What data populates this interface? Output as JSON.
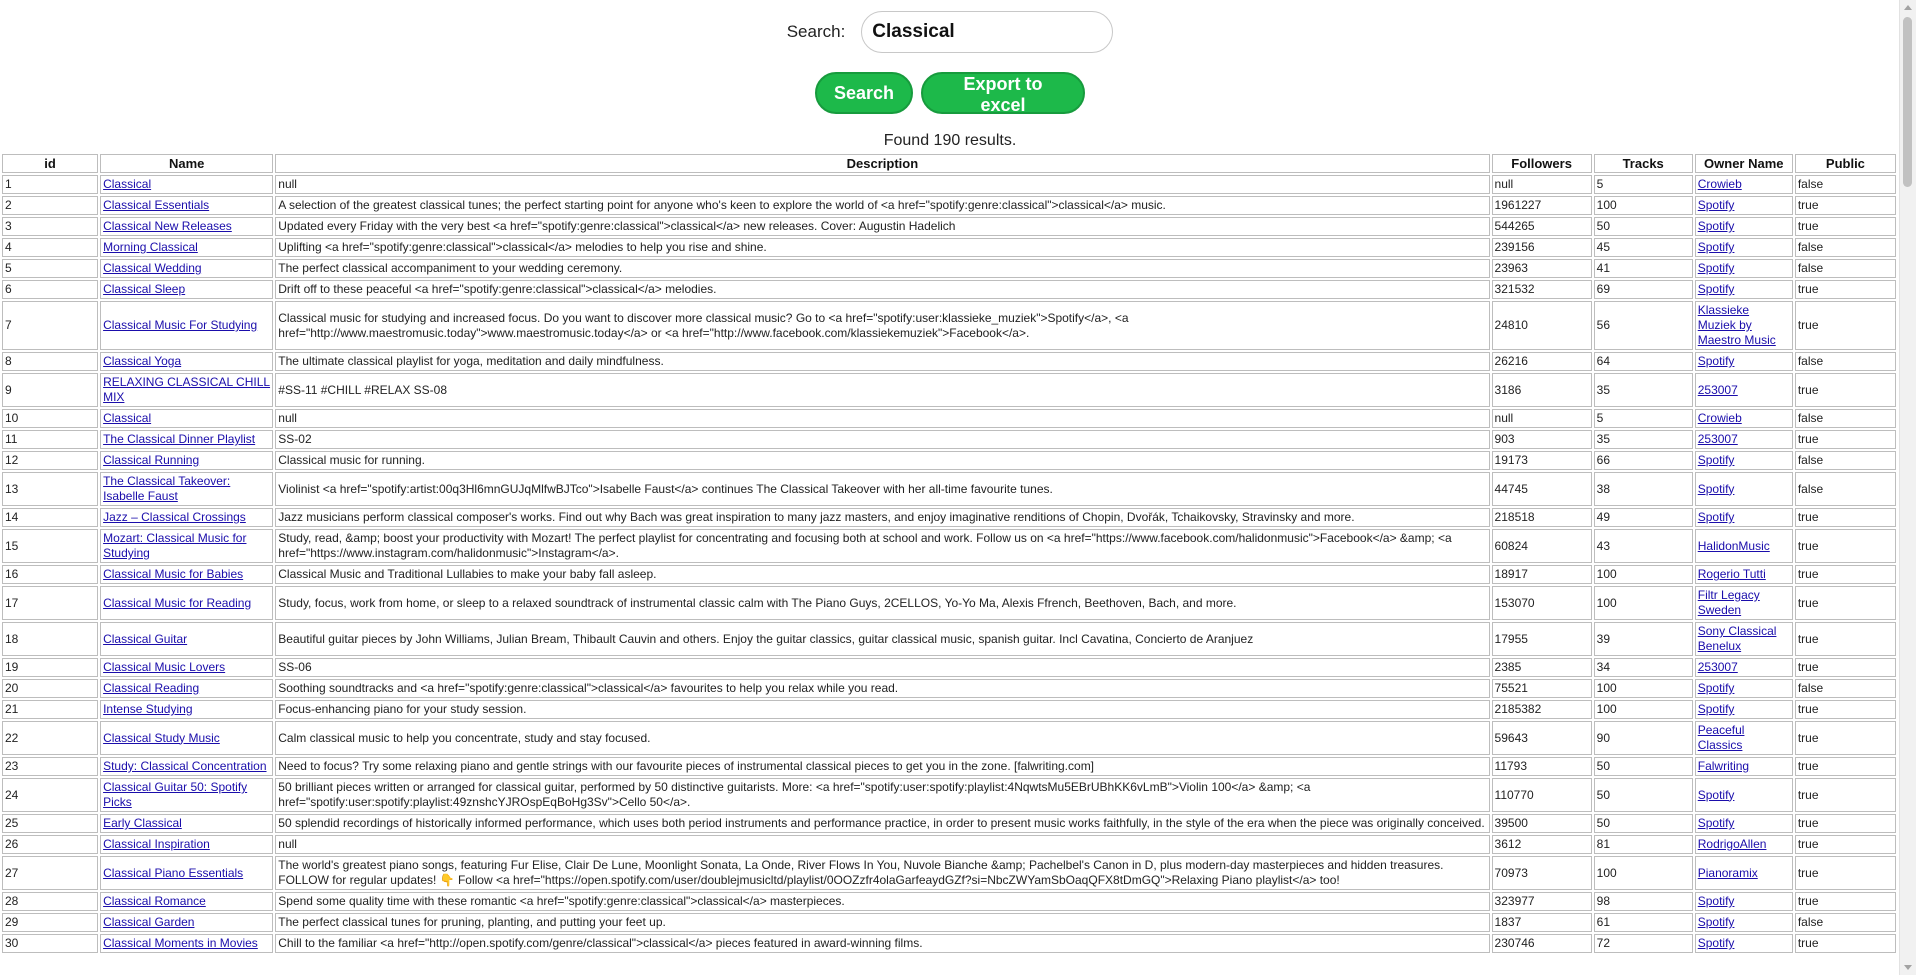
{
  "search": {
    "label": "Search:",
    "value": "Classical"
  },
  "buttons": {
    "search": "Search",
    "export": "Export to excel"
  },
  "results": {
    "text": "Found 190 results."
  },
  "table": {
    "headers": [
      "id",
      "Name",
      "Description",
      "Followers",
      "Tracks",
      "Owner Name",
      "Public"
    ],
    "rows": [
      [
        "1",
        "Classical",
        "null",
        "null",
        "5",
        "Crowieb",
        "false"
      ],
      [
        "2",
        "Classical Essentials",
        "A selection of the greatest classical tunes; the perfect starting point for anyone who's keen to explore the world of <a href=\"spotify:genre:classical\">classical</a> music.",
        "1961227",
        "100",
        "Spotify",
        "true"
      ],
      [
        "3",
        "Classical New Releases",
        "Updated every Friday with the very best <a href=\"spotify:genre:classical\">classical</a> new releases. Cover: Augustin Hadelich",
        "544265",
        "50",
        "Spotify",
        "true"
      ],
      [
        "4",
        "Morning Classical",
        "Uplifting <a href=\"spotify:genre:classical\">classical</a> melodies to help you rise and shine.",
        "239156",
        "45",
        "Spotify",
        "false"
      ],
      [
        "5",
        "Classical Wedding",
        "The perfect classical accompaniment to your wedding ceremony.",
        "23963",
        "41",
        "Spotify",
        "false"
      ],
      [
        "6",
        "Classical Sleep",
        "Drift off to these peaceful <a href=\"spotify:genre:classical\">classical</a> melodies.",
        "321532",
        "69",
        "Spotify",
        "true"
      ],
      [
        "7",
        "Classical Music For Studying",
        "Classical music for studying and increased focus. Do you want to discover more classical music? Go to <a href=\"spotify:user:klassieke_muziek\">Spotify</a>, <a href=\"http://www.maestromusic.today\">www.maestromusic.today</a> or <a href=\"http://www.facebook.com/klassiekemuziek\">Facebook</a>.",
        "24810",
        "56",
        "Klassieke Muziek by Maestro Music",
        "true"
      ],
      [
        "8",
        "Classical Yoga",
        "The ultimate classical playlist for yoga, meditation and daily mindfulness.",
        "26216",
        "64",
        "Spotify",
        "false"
      ],
      [
        "9",
        "RELAXING CLASSICAL CHILL MIX",
        "#SS-11 #CHILL #RELAX SS-08",
        "3186",
        "35",
        "253007",
        "true"
      ],
      [
        "10",
        "Classical",
        "null",
        "null",
        "5",
        "Crowieb",
        "false"
      ],
      [
        "11",
        "The Classical Dinner Playlist",
        "SS-02",
        "903",
        "35",
        "253007",
        "true"
      ],
      [
        "12",
        "Classical Running",
        "Classical music for running.",
        "19173",
        "66",
        "Spotify",
        "false"
      ],
      [
        "13",
        "The Classical Takeover: Isabelle Faust",
        "Violinist <a href=\"spotify:artist:00q3Hl6mnGUJqMlfwBJTco\">Isabelle Faust</a> continues The Classical Takeover with her all-time favourite tunes.",
        "44745",
        "38",
        "Spotify",
        "false"
      ],
      [
        "14",
        "Jazz – Classical Crossings",
        "Jazz musicians perform classical composer's works. Find out why Bach was great inspiration to many jazz masters, and enjoy imaginative renditions of Chopin, Dvořák, Tchaikovsky, Stravinsky and more.",
        "218518",
        "49",
        "Spotify",
        "true"
      ],
      [
        "15",
        "Mozart: Classical Music for Studying",
        "Study, read, &amp; boost your productivity with Mozart! The perfect playlist for concentrating and focusing both at school and work. Follow us on <a href=\"https://www.facebook.com/halidonmusic\">Facebook</a> &amp; <a href=\"https://www.instagram.com/halidonmusic\">Instagram</a>.",
        "60824",
        "43",
        "HalidonMusic",
        "true"
      ],
      [
        "16",
        "Classical Music for Babies",
        "Classical Music and Traditional Lullabies to make your baby fall asleep.",
        "18917",
        "100",
        "Rogerio Tutti",
        "true"
      ],
      [
        "17",
        "Classical Music for Reading",
        "Study, focus, work from home, or sleep to a relaxed soundtrack of instrumental classic calm with The Piano Guys, 2CELLOS, Yo-Yo Ma, Alexis Ffrench, Beethoven, Bach, and more.",
        "153070",
        "100",
        "Filtr Legacy Sweden",
        "true"
      ],
      [
        "18",
        "Classical Guitar",
        "Beautiful guitar pieces by John Williams, Julian Bream, Thibault Cauvin and others. Enjoy the guitar classics, guitar classical music, spanish guitar. Incl Cavatina, Concierto de Aranjuez",
        "17955",
        "39",
        "Sony Classical Benelux",
        "true"
      ],
      [
        "19",
        "Classical Music Lovers",
        "SS-06",
        "2385",
        "34",
        "253007",
        "true"
      ],
      [
        "20",
        "Classical Reading",
        "Soothing soundtracks and <a href=\"spotify:genre:classical\">classical</a> favourites to help you relax while you read.",
        "75521",
        "100",
        "Spotify",
        "false"
      ],
      [
        "21",
        "Intense Studying",
        "Focus-enhancing piano for your study session.",
        "2185382",
        "100",
        "Spotify",
        "true"
      ],
      [
        "22",
        "Classical Study Music",
        "Calm classical music to help you concentrate, study and stay focused.",
        "59643",
        "90",
        "Peaceful Classics",
        "true"
      ],
      [
        "23",
        "Study: Classical Concentration",
        "Need to focus? Try some relaxing piano and gentle strings with our favourite pieces of instrumental classical pieces to get you in the zone. [falwriting.com]",
        "11793",
        "50",
        "Falwriting",
        "true"
      ],
      [
        "24",
        "Classical Guitar 50: Spotify Picks",
        "50 brilliant pieces written or arranged for classical guitar, performed by 50 distinctive guitarists. More: <a href=\"spotify:user:spotify:playlist:4NqwtsMu5EBrUBhKK6vLmB\">Violin 100</a> &amp; <a href=\"spotify:user:spotify:playlist:49znshcYJROspEqBoHg3Sv\">Cello 50</a>.",
        "110770",
        "50",
        "Spotify",
        "true"
      ],
      [
        "25",
        "Early Classical",
        "50 splendid recordings of historically informed performance, which uses both period instruments and performance practice, in order to present music works faithfully, in the style of the era when the piece was originally conceived.",
        "39500",
        "50",
        "Spotify",
        "true"
      ],
      [
        "26",
        "Classical Inspiration",
        "null",
        "3612",
        "81",
        "RodrigoAllen",
        "true"
      ],
      [
        "27",
        "Classical Piano Essentials",
        "The world's greatest piano songs, featuring Fur Elise, Clair De Lune, Moonlight Sonata, La Onde, River Flows In You, Nuvole Bianche &amp; Pachelbel's Canon in D, plus modern-day masterpieces and hidden treasures. FOLLOW for regular updates! 👇 Follow <a href=\"https://open.spotify.com/user/doublejmusicltd/playlist/0OOZzfr4olaGarfeaydGZf?si=NbcZWYamSbOaqQFX8tDmGQ\">Relaxing Piano playlist</a> too!",
        "70973",
        "100",
        "Pianoramix",
        "true"
      ],
      [
        "28",
        "Classical Romance",
        "Spend some quality time with these romantic <a href=\"spotify:genre:classical\">classical</a> masterpieces.",
        "323977",
        "98",
        "Spotify",
        "true"
      ],
      [
        "29",
        "Classical Garden",
        "The perfect classical tunes for pruning, planting, and putting your feet up.",
        "1837",
        "61",
        "Spotify",
        "false"
      ],
      [
        "30",
        "Classical Moments in Movies",
        "Chill to the familiar <a href=\"http://open.spotify.com/genre/classical\">classical</a> pieces featured in award-winning films.",
        "230746",
        "72",
        "Spotify",
        "true"
      ]
    ]
  }
}
